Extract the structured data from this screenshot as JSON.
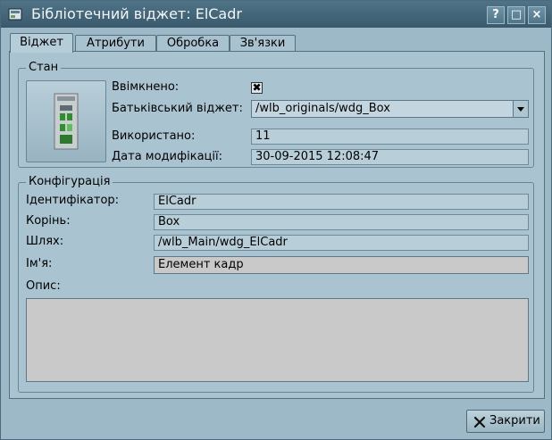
{
  "window": {
    "title": "Бібліотечний віджет: ElCadr",
    "buttons": {
      "help": "?",
      "maximize": "□",
      "close": "×"
    }
  },
  "tabs": [
    "Віджет",
    "Атрибути",
    "Обробка",
    "Зв'язки"
  ],
  "state": {
    "group_title": "Стан",
    "enabled_label": "Ввімкнено:",
    "enabled_checked": true,
    "parent_label": "Батьківський віджет:",
    "parent_value": "/wlb_originals/wdg_Box",
    "used_label": "Використано:",
    "used_value": "11",
    "modified_label": "Дата модифікації:",
    "modified_value": "30-09-2015 12:08:47"
  },
  "config": {
    "group_title": "Конфігурація",
    "id_label": "Ідентифікатор:",
    "id_value": "ElCadr",
    "root_label": "Корінь:",
    "root_value": "Box",
    "path_label": "Шлях:",
    "path_value": "/wlb_Main/wdg_ElCadr",
    "name_label": "Ім'я:",
    "name_value": "Елемент кадр",
    "desc_label": "Опис:",
    "desc_value": ""
  },
  "footer": {
    "close_label": "Закрити"
  },
  "icons": {
    "title": "app-logo-icon",
    "close": "close-x-icon",
    "preview": "widget-preview-icon"
  }
}
